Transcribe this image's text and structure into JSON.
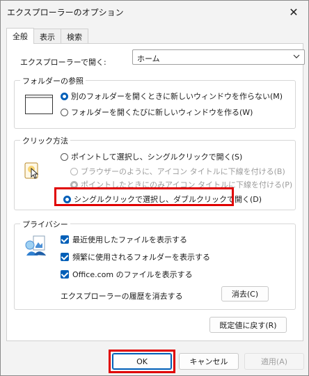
{
  "window": {
    "title": "エクスプローラーのオプション",
    "close_glyph": "✕"
  },
  "tabs": [
    {
      "label": "全般",
      "active": true
    },
    {
      "label": "表示",
      "active": false
    },
    {
      "label": "検索",
      "active": false
    }
  ],
  "open_explorer": {
    "label": "エクスプローラーで開く:",
    "value": "ホーム"
  },
  "folder_browse": {
    "legend": "フォルダーの参照",
    "options": [
      {
        "label": "別のフォルダーを開くときに新しいウィンドウを作らない(M)",
        "selected": true
      },
      {
        "label": "フォルダーを開くたびに新しいウィンドウを作る(W)",
        "selected": false
      }
    ]
  },
  "click_method": {
    "legend": "クリック方法",
    "options": [
      {
        "label": "ポイントして選択し、シングルクリックで開く(S)",
        "selected": false
      },
      {
        "label": "ブラウザーのように、アイコン タイトルに下線を付ける(B)",
        "selected": false,
        "disabled": true
      },
      {
        "label": "ポイントしたときにのみアイコン タイトルに下線を付ける(P)",
        "selected": true,
        "disabled": true
      },
      {
        "label": "シングルクリックで選択し、ダブルクリックで開く(D)",
        "selected": true
      }
    ]
  },
  "privacy": {
    "legend": "プライバシー",
    "checks": [
      {
        "label": "最近使用したファイルを表示する",
        "checked": true
      },
      {
        "label": "頻繁に使用されるフォルダーを表示する",
        "checked": true
      },
      {
        "label": "Office.com のファイルを表示する",
        "checked": true
      }
    ],
    "clear_label": "エクスプローラーの履歴を消去する",
    "clear_button": "消去(C)"
  },
  "restore_button": "既定値に戻す(R)",
  "footer": {
    "ok": "OK",
    "cancel": "キャンセル",
    "apply": "適用(A)"
  },
  "colors": {
    "accent": "#005fb8",
    "highlight": "#e00000"
  },
  "icons": {
    "window_preview": "window-preview-icon",
    "cursor_click": "pointer-click-icon",
    "privacy": "privacy-icon"
  }
}
